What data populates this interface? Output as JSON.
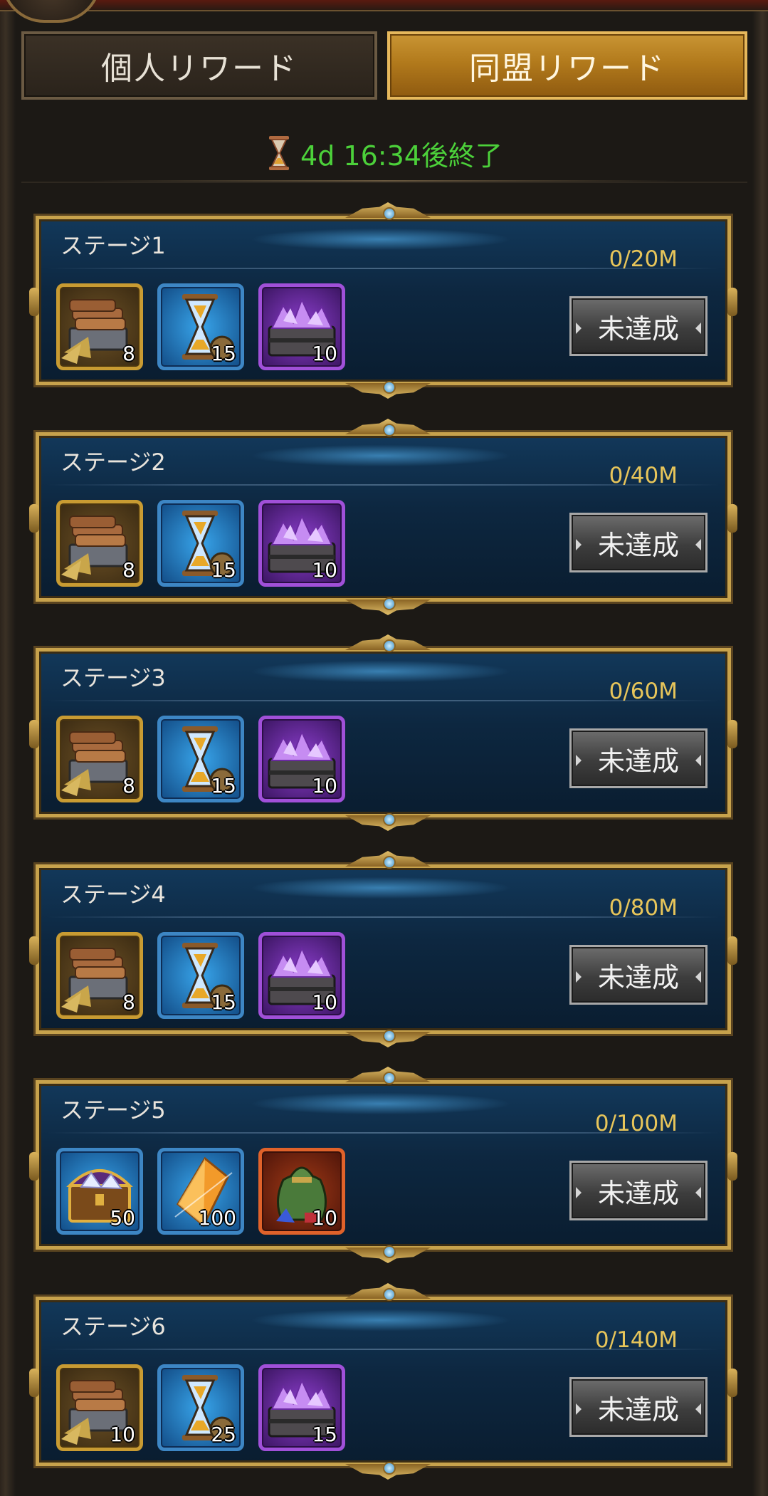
{
  "tabs": {
    "personal": "個人リワード",
    "alliance": "同盟リワード"
  },
  "timer": {
    "text": "4d 16:34後終了",
    "color": "#4cd13a"
  },
  "stages": [
    {
      "title": "ステージ1",
      "progress": "0/20M",
      "status": "未達成",
      "items": [
        {
          "icon": "lumber-cart-icon",
          "count": "8"
        },
        {
          "icon": "speedup-hourglass-icon",
          "count": "15"
        },
        {
          "icon": "purple-crystal-chest-icon",
          "count": "10"
        }
      ]
    },
    {
      "title": "ステージ2",
      "progress": "0/40M",
      "status": "未達成",
      "items": [
        {
          "icon": "lumber-cart-icon",
          "count": "8"
        },
        {
          "icon": "speedup-hourglass-icon",
          "count": "15"
        },
        {
          "icon": "purple-crystal-chest-icon",
          "count": "10"
        }
      ]
    },
    {
      "title": "ステージ3",
      "progress": "0/60M",
      "status": "未達成",
      "items": [
        {
          "icon": "lumber-cart-icon",
          "count": "8"
        },
        {
          "icon": "speedup-hourglass-icon",
          "count": "15"
        },
        {
          "icon": "purple-crystal-chest-icon",
          "count": "10"
        }
      ]
    },
    {
      "title": "ステージ4",
      "progress": "0/80M",
      "status": "未達成",
      "items": [
        {
          "icon": "lumber-cart-icon",
          "count": "8"
        },
        {
          "icon": "speedup-hourglass-icon",
          "count": "15"
        },
        {
          "icon": "purple-crystal-chest-icon",
          "count": "10"
        }
      ]
    },
    {
      "title": "ステージ5",
      "progress": "0/100M",
      "status": "未達成",
      "items": [
        {
          "icon": "treasure-chest-icon",
          "count": "50"
        },
        {
          "icon": "orange-crystal-shard-icon",
          "count": "100"
        },
        {
          "icon": "resource-sack-icon",
          "count": "10"
        }
      ]
    },
    {
      "title": "ステージ6",
      "progress": "0/140M",
      "status": "未達成",
      "items": [
        {
          "icon": "lumber-cart-icon",
          "count": "10"
        },
        {
          "icon": "speedup-hourglass-icon",
          "count": "25"
        },
        {
          "icon": "purple-crystal-chest-icon",
          "count": "15"
        }
      ]
    }
  ]
}
